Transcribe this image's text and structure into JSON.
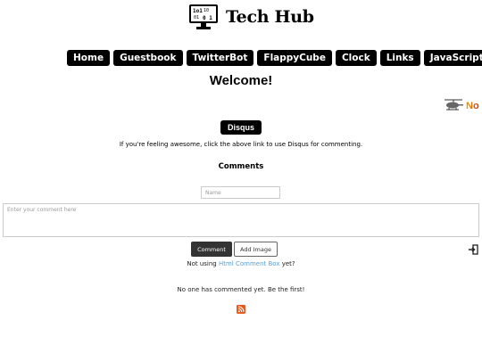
{
  "header": {
    "title": "Tech Hub",
    "logo_icon": "binary-monitor-icon"
  },
  "nav": [
    {
      "label": "Home"
    },
    {
      "label": "Guestbook"
    },
    {
      "label": "TwitterBot"
    },
    {
      "label": "FlappyCube"
    },
    {
      "label": "Clock"
    },
    {
      "label": "Links"
    },
    {
      "label": "JavaScript"
    }
  ],
  "main": {
    "heading": "Welcome!",
    "side_text": "No",
    "side_icon": "helicopter-icon",
    "disqus_button": "Disqus",
    "disqus_note": "If you're feeling awesome, click the above link to use Disqus for commenting.",
    "comments_heading": "Comments"
  },
  "form": {
    "name_placeholder": "Name",
    "comment_placeholder": "Enter your comment here",
    "comment_button": "Comment",
    "add_image_button": "Add Image",
    "login_icon": "login-icon"
  },
  "footer": {
    "not_using_prefix": "Not using ",
    "not_using_link": "Html Comment Box",
    "not_using_suffix": " yet?",
    "no_comments": "No one has commented yet. Be the first!",
    "rss_icon": "rss-icon",
    "rss_color": "#e85a1e"
  }
}
